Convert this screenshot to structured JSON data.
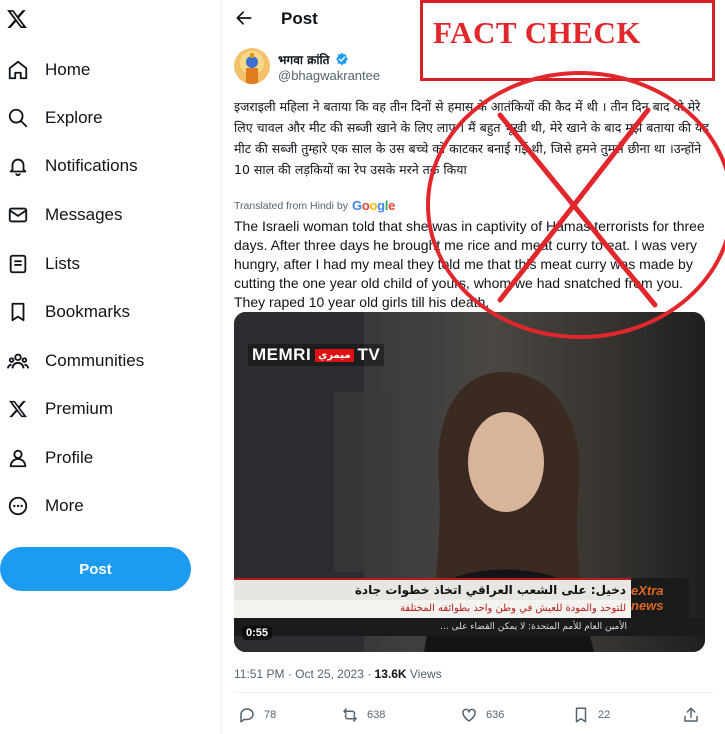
{
  "sidebar": {
    "logo": "x-logo-icon",
    "items": [
      {
        "label": "Home",
        "icon": "home-icon"
      },
      {
        "label": "Explore",
        "icon": "search-icon"
      },
      {
        "label": "Notifications",
        "icon": "bell-icon"
      },
      {
        "label": "Messages",
        "icon": "mail-icon"
      },
      {
        "label": "Lists",
        "icon": "list-icon"
      },
      {
        "label": "Bookmarks",
        "icon": "bookmark-icon"
      },
      {
        "label": "Communities",
        "icon": "people-icon"
      },
      {
        "label": "Premium",
        "icon": "x-logo-icon"
      },
      {
        "label": "Profile",
        "icon": "person-icon"
      },
      {
        "label": "More",
        "icon": "more-circle-icon"
      }
    ],
    "post_button": "Post"
  },
  "header": {
    "title": "Post"
  },
  "overlay": {
    "fact_check": "FACT CHECK",
    "accent": "#e1262c"
  },
  "tweet": {
    "author_name": "भगवा क्रांति",
    "handle": "@bhagwakrantee",
    "hindi_text": "इजराइली महिला ने बताया कि वह तीन दिनों से हमास के आतंकियों की कैद में थी । तीन दिन बाद वो मेरे लिए चावल और मीट की सब्जी खाने के लिए लाए ।  मैं बहुत भूखी थी, मेरे खाने के बाद मुझे बताया की यह मीट की सब्जी तुम्हारे एक साल के उस बच्चे को काटकर बनाई गई थी, जिसे हमने तुमसे छीना था ।उन्होंने 10 साल की लड़कियों का रेप उसके मरने तक किया",
    "translated_label": "Translated from Hindi by",
    "translator": "Google",
    "english_text": "The Israeli woman told that she was in captivity of Hamas terrorists for three days. After three days he brought me rice and meat curry to eat. I was very hungry, after I had my meal they told me that this meat curry was made by cutting the one year old child of yours, whom we had snatched from you. They raped 10 year old girls till his death.",
    "video": {
      "channel_logo": "MEMRI TV",
      "channel_badge": "ميمري",
      "network_logo": "eXtra news",
      "ticker_headline": "دخيل: على الشعب العراقي اتخاذ خطوات جادة",
      "ticker_sub": "للتوحد والمودة للعيش في وطن واحد بطوائفه المختلفة",
      "ticker_bottom": "الأمين العام للأمم المتحدة: لا يمكن القضاء على ...",
      "duration": "0:55"
    },
    "time": "11:51 PM",
    "date": "Oct 25, 2023",
    "views_count": "13.6K",
    "views_label": "Views",
    "replies": "78",
    "reposts": "638",
    "likes": "636",
    "bookmarks": "22"
  }
}
